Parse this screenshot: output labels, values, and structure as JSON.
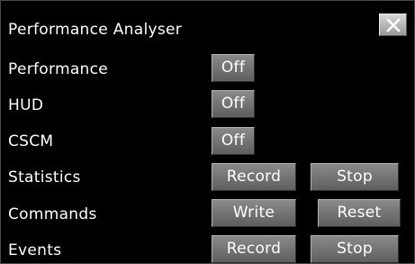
{
  "panel": {
    "title": "Performance Analyser",
    "close_icon": "close-x-icon"
  },
  "rows": {
    "performance": {
      "label": "Performance",
      "toggle": "Off"
    },
    "hud": {
      "label": "HUD",
      "toggle": "Off"
    },
    "cscm": {
      "label": "CSCM",
      "toggle": "Off"
    },
    "statistics": {
      "label": "Statistics",
      "primary": "Record",
      "secondary": "Stop"
    },
    "commands": {
      "label": "Commands",
      "primary": "Write",
      "secondary": "Reset"
    },
    "events": {
      "label": "Events",
      "primary": "Record",
      "secondary": "Stop"
    }
  }
}
